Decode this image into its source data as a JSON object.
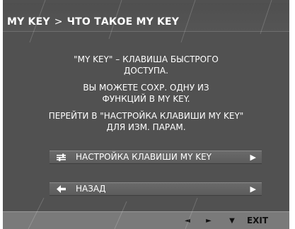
{
  "title": {
    "section": "MY KEY",
    "separator": ">",
    "page": "ЧТО ТАКОЕ MY KEY"
  },
  "description": {
    "line1": "\"MY KEY\" – КЛАВИША БЫСТРОГО",
    "line2": "ДОСТУПА.",
    "line3": "ВЫ МОЖЕТЕ СОХР. ОДНУ ИЗ",
    "line4": "ФУНКЦИЙ В MY KEY.",
    "line5": "ПЕРЕЙТИ В \"НАСТРОЙКА КЛАВИШИ MY KEY\"",
    "line6": "ДЛЯ ИЗМ. ПАРАМ."
  },
  "menu": {
    "items": [
      {
        "label": "НАСТРОЙКА КЛАВИШИ MY KEY",
        "icon": "settings-sliders-icon",
        "arrow": "▶"
      },
      {
        "label": "НАЗАД",
        "icon": "back-arrow-icon",
        "arrow": "▶"
      }
    ]
  },
  "bottom_bar": {
    "left": "◄",
    "right": "►",
    "down": "▼",
    "exit": "EXIT"
  },
  "colors": {
    "background": "#515151",
    "bottom_bar": "#7a7a7a",
    "text": "#ffffff"
  }
}
